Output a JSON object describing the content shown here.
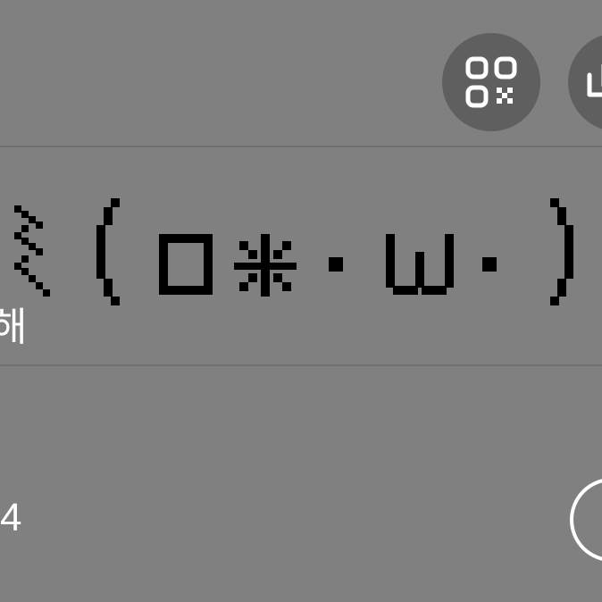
{
  "kaomoji": {
    "text": "≷(O✻·ω·)",
    "caption": "해"
  },
  "footer": {
    "count": "4"
  },
  "actions": {
    "qr_icon": "qr-code-icon",
    "share_icon": "share-icon",
    "more_icon": "circle-button"
  },
  "colors": {
    "background": "#808080",
    "button_fill": "#5f5f5f",
    "text": "#ffffff",
    "art": "#000000"
  }
}
